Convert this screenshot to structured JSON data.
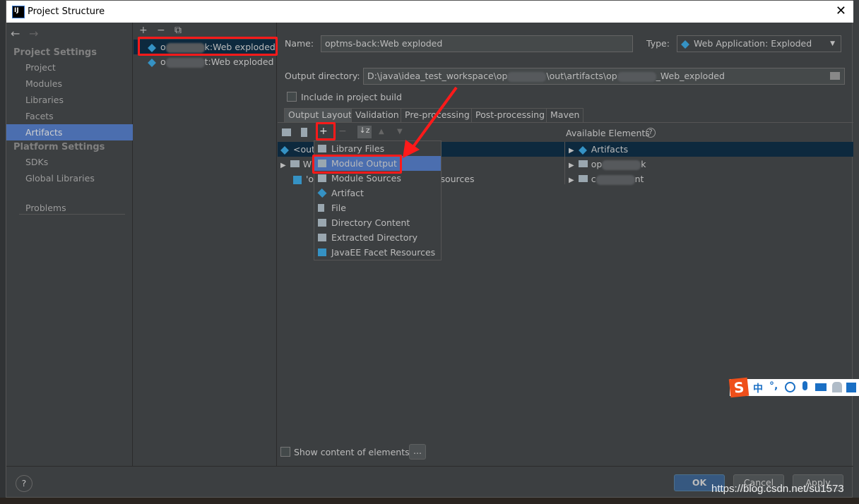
{
  "window": {
    "title": "Project Structure",
    "close": "✕",
    "logo": "IJ"
  },
  "nav": {
    "back": "←",
    "forward": "→"
  },
  "sidebar": {
    "project_settings": "Project Settings",
    "items": [
      {
        "label": "Project"
      },
      {
        "label": "Modules"
      },
      {
        "label": "Libraries"
      },
      {
        "label": "Facets"
      },
      {
        "label": "Artifacts",
        "selected": true
      }
    ],
    "platform_settings": "Platform Settings",
    "platform_items": [
      {
        "label": "SDKs"
      },
      {
        "label": "Global Libraries"
      }
    ],
    "problems": "Problems"
  },
  "artifacts": {
    "toolbar": {
      "add": "+",
      "remove": "−",
      "copy": "⧉"
    },
    "items": [
      {
        "prefix": "o",
        "suffix": "k:Web exploded",
        "selected": true
      },
      {
        "prefix": "o",
        "suffix": "t:Web exploded"
      }
    ]
  },
  "detail": {
    "name_label": "Name:",
    "name_value": "optms-back:Web exploded",
    "type_label": "Type:",
    "type_value": "Web Application: Exploded",
    "output_label": "Output directory:",
    "output_part1": "D:\\java\\idea_test_workspace\\op",
    "output_part2": "\\out\\artifacts\\op",
    "output_part3": "_Web_exploded",
    "include_label": "Include in project build",
    "tabs": [
      "Output Layout",
      "Validation",
      "Pre-processing",
      "Post-processing",
      "Maven"
    ],
    "available_label": "Available Elements",
    "tree": [
      {
        "text": "<outp"
      },
      {
        "text": "W"
      },
      {
        "text": "'op",
        "tail": "t resources"
      }
    ],
    "available": [
      {
        "text": "Artifacts"
      },
      {
        "prefix": "op",
        "suffix": "k"
      },
      {
        "prefix": "c",
        "suffix": "nt"
      }
    ],
    "show_content": "Show content of elements",
    "ellipsis": "..."
  },
  "menu": {
    "items": [
      {
        "label": "Library Files",
        "icon": "library-icon"
      },
      {
        "label": "Module Output",
        "icon": "module-output-icon",
        "selected": true
      },
      {
        "label": "Module Sources",
        "icon": "module-sources-icon"
      },
      {
        "label": "Artifact",
        "icon": "artifact-icon"
      },
      {
        "label": "File",
        "icon": "file-icon"
      },
      {
        "label": "Directory Content",
        "icon": "directory-icon"
      },
      {
        "label": "Extracted Directory",
        "icon": "extracted-directory-icon"
      },
      {
        "label": "JavaEE Facet Resources",
        "icon": "javaee-icon"
      }
    ]
  },
  "footer": {
    "help": "?",
    "ok": "OK",
    "cancel": "Cancel",
    "apply": "Apply"
  },
  "ime": {
    "zh": "中",
    "punct": "°,"
  },
  "watermark": "https://blog.csdn.net/su1573",
  "colors": {
    "accent": "#4b6eaf",
    "annotation": "#ff1a1a",
    "background": "#3c3f41"
  }
}
